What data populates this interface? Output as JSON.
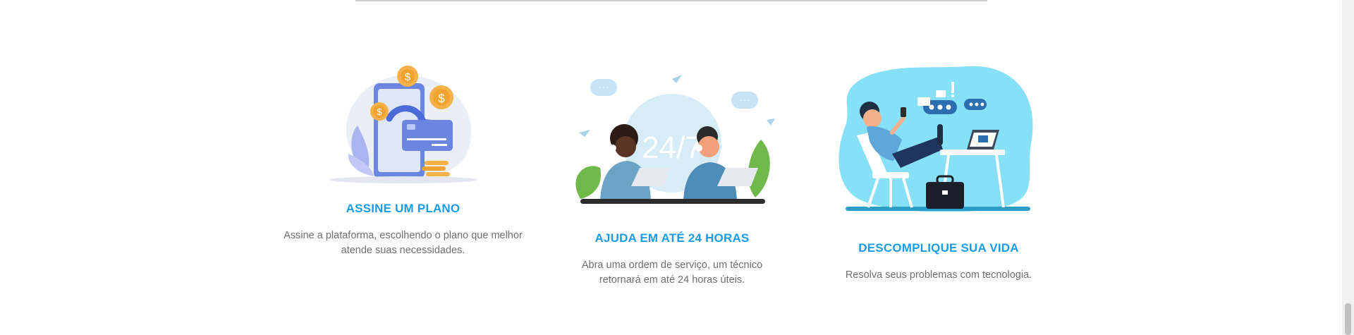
{
  "features": [
    {
      "title": "ASSINE UM PLANO",
      "description": "Assine a plataforma, escolhendo o plano que melhor atende suas necessidades.",
      "illustration": "subscription-payment-illustration"
    },
    {
      "title": "AJUDA EM ATÉ 24 HORAS",
      "description": "Abra uma ordem de serviço, um técnico retornará em até 24 horas úteis.",
      "illustration": "support-24-7-illustration",
      "illustration_text": "24/7"
    },
    {
      "title": "DESCOMPLIQUE SUA VIDA",
      "description": "Resolva seus problemas com tecnologia.",
      "illustration": "relaxed-person-illustration"
    }
  ],
  "colors": {
    "accent": "#1a9be6",
    "text": "#6f6f6f",
    "divider": "#cfcfcf"
  }
}
